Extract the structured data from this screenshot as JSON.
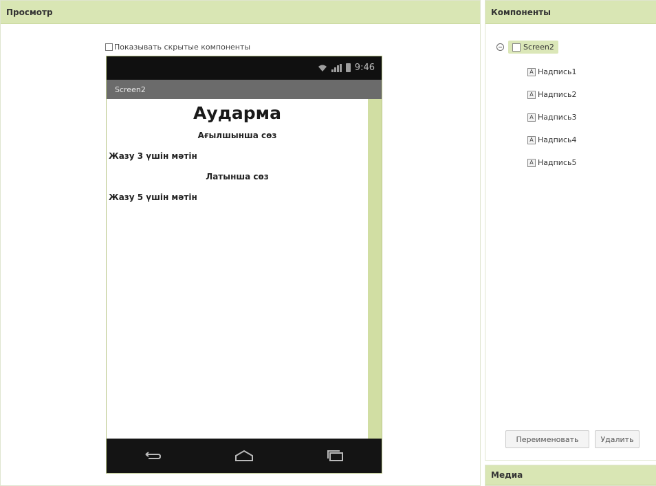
{
  "viewer": {
    "title": "Просмотр",
    "show_hidden_label": "Показывать скрытые компоненты",
    "phone": {
      "time": "9:46",
      "screen_title": "Screen2",
      "labels": [
        "Аударма",
        "Ағылшынша сөз",
        "Жазу 3 үшін мәтін",
        "Латынша сөз",
        "Жазу 5 үшін мәтін"
      ]
    }
  },
  "components": {
    "title": "Компоненты",
    "root": "Screen2",
    "children": [
      "Надпись1",
      "Надпись2",
      "Надпись3",
      "Надпись4",
      "Надпись5"
    ],
    "rename_button": "Переименовать",
    "delete_button": "Удалить"
  },
  "media": {
    "title": "Медиа"
  },
  "colors": {
    "header_bg": "#d9e6b4",
    "scrollbar": "#d1dea3",
    "statusbar": "#101010",
    "titlebar": "#6b6b6b"
  }
}
